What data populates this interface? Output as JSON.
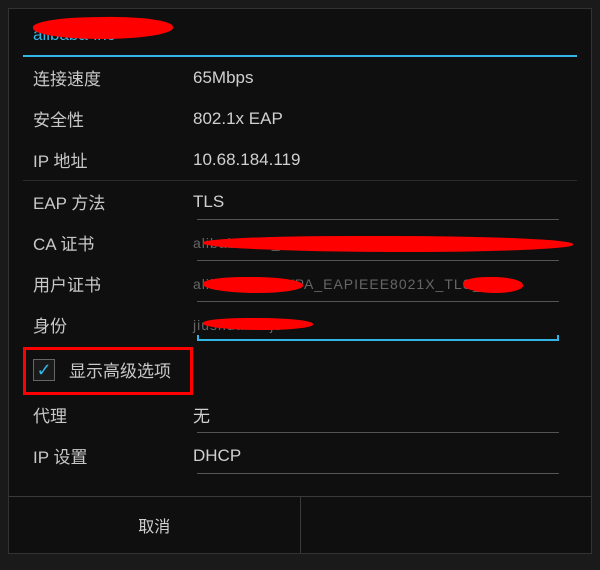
{
  "title": "alibaba-inc",
  "info": {
    "link_speed_label": "连接速度",
    "link_speed_value": "65Mbps",
    "security_label": "安全性",
    "security_value": "802.1x EAP",
    "ip_label": "IP 地址",
    "ip_value": "10.68.184.119"
  },
  "fields": {
    "eap_label": "EAP 方法",
    "eap_value": "TLS",
    "ca_cert_label": "CA 证书",
    "ca_cert_value": "alibaba-inc_WPA_EAPIEEE8021X_TLS_NULL",
    "user_cert_label": "用户证书",
    "user_cert_value": "alibaba-inc_WPA_EAPIEEE8021X_TLS_NULL",
    "identity_label": "身份",
    "identity_value": "jiushuai.xujs"
  },
  "advanced": {
    "show_advanced_label": "显示高级选项",
    "proxy_label": "代理",
    "proxy_value": "无",
    "ip_settings_label": "IP 设置",
    "ip_settings_value": "DHCP"
  },
  "buttons": {
    "cancel": "取消",
    "save": ""
  }
}
